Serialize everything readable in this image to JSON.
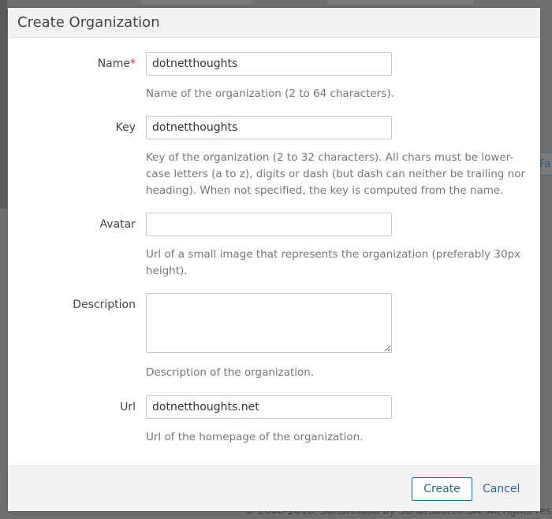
{
  "background": {
    "fav_button_label": "Fa",
    "footer_text": "© 2008-2018, SonarCloud by SonarSource SA. All rights res"
  },
  "modal": {
    "title": "Create Organization"
  },
  "form": {
    "name": {
      "label": "Name",
      "required_mark": "*",
      "value": "dotnetthoughts",
      "help": "Name of the organization (2 to 64 characters)."
    },
    "key": {
      "label": "Key",
      "value": "dotnetthoughts",
      "help": "Key of the organization (2 to 32 characters). All chars must be lower-case letters (a to z), digits or dash (but dash can neither be trailing nor heading). When not specified, the key is computed from the name."
    },
    "avatar": {
      "label": "Avatar",
      "value": "",
      "help": "Url of a small image that represents the organization (preferably 30px height)."
    },
    "description": {
      "label": "Description",
      "value": "",
      "help": "Description of the organization."
    },
    "url": {
      "label": "Url",
      "value": "dotnetthoughts.net",
      "help": "Url of the homepage of the organization."
    }
  },
  "footer": {
    "create_label": "Create",
    "cancel_label": "Cancel"
  },
  "colors": {
    "accent": "#236a97",
    "required": "#d02f3a",
    "overlay": "#6f6f6f"
  }
}
